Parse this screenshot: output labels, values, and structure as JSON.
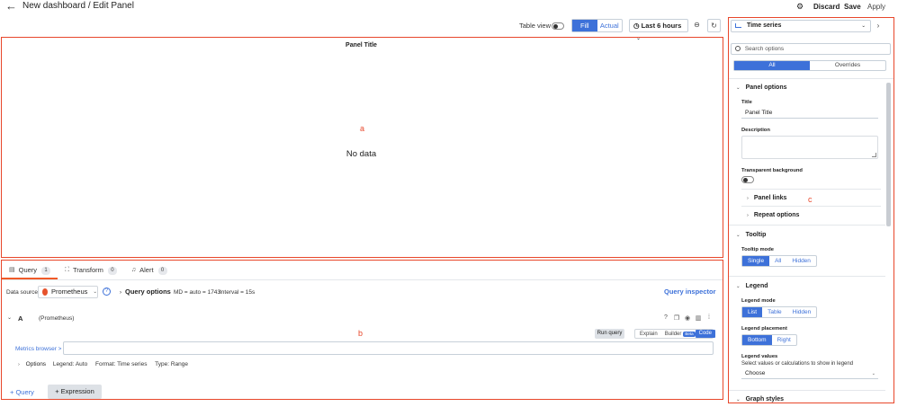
{
  "header": {
    "back_icon": "arrow-left-icon",
    "title": "New dashboard / Edit Panel",
    "settings_icon": "gear-icon",
    "discard": "Discard",
    "save": "Save",
    "apply": "Apply"
  },
  "toolbar": {
    "table_view": "Table view",
    "fill": "Fill",
    "actual": "Actual",
    "time_range": "Last 6 hours",
    "zoom_icon": "zoom-out-icon",
    "refresh_icon": "refresh-icon"
  },
  "annotations": {
    "a": "a",
    "b": "b",
    "c": "c"
  },
  "panel": {
    "title": "Panel Title",
    "message": "No data"
  },
  "query_tabs": [
    {
      "label": "Query",
      "count": "1"
    },
    {
      "label": "Transform",
      "count": "0"
    },
    {
      "label": "Alert",
      "count": "0"
    }
  ],
  "datasource": {
    "label": "Data source",
    "value": "Prometheus",
    "query_options": "Query options",
    "md": "MD = auto = 1743",
    "interval": "Interval = 15s",
    "inspector": "Query inspector"
  },
  "query_a": {
    "name": "A",
    "datasource": "(Prometheus)",
    "run_query": "Run query",
    "explain": "Explain",
    "builder": "Builder",
    "beta": "Beta",
    "code": "Code",
    "metrics_browser": "Metrics browser >",
    "options_label": "Options",
    "legend": "Legend: Auto",
    "format": "Format: Time series",
    "type": "Type: Range"
  },
  "footer": {
    "add_query": "+ Query",
    "add_expression": "+ Expression"
  },
  "options_pane": {
    "visualization": "Time series",
    "search_placeholder": "Search options",
    "tab_all": "All",
    "tab_overrides": "Overrides",
    "panel_options": "Panel options",
    "title_label": "Title",
    "title_value": "Panel Title",
    "description_label": "Description",
    "transparent_label": "Transparent background",
    "panel_links": "Panel links",
    "repeat_options": "Repeat options",
    "tooltip": "Tooltip",
    "tooltip_mode_label": "Tooltip mode",
    "tooltip_modes": [
      "Single",
      "All",
      "Hidden"
    ],
    "legend": "Legend",
    "legend_mode_label": "Legend mode",
    "legend_modes": [
      "List",
      "Table",
      "Hidden"
    ],
    "legend_placement_label": "Legend placement",
    "legend_placements": [
      "Bottom",
      "Right"
    ],
    "legend_values_label": "Legend values",
    "legend_values_hint": "Select values or calculations to show in legend",
    "legend_values_choose": "Choose",
    "graph_styles": "Graph styles"
  }
}
